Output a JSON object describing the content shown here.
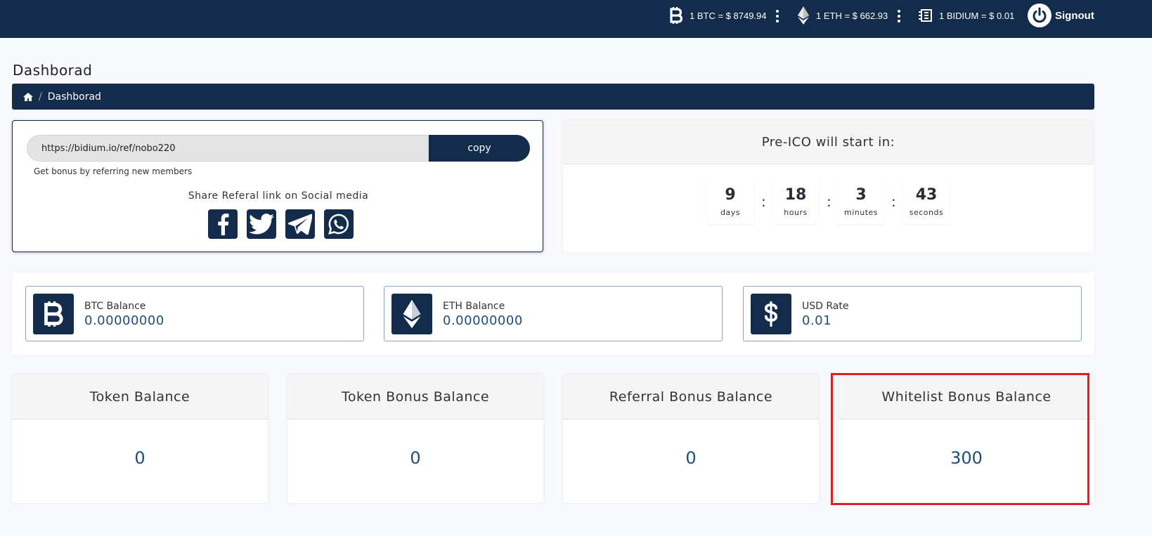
{
  "topbar": {
    "rates": [
      {
        "icon": "bitcoin-icon",
        "label": "1 BTC = $ 8749.94"
      },
      {
        "icon": "ethereum-icon",
        "label": "1 ETH = $ 662.93"
      },
      {
        "icon": "bidium-icon",
        "label": "1 BIDIUM = $ 0.01"
      }
    ],
    "signout_label": "Signout"
  },
  "page": {
    "title": "Dashborad",
    "breadcrumb": {
      "current": "Dashborad"
    }
  },
  "referral": {
    "link": "https://bidium.io/ref/nobo220",
    "copy_label": "copy",
    "hint": "Get bonus by referring new members",
    "share_title": "Share Referal link on Social media",
    "socials": [
      "facebook",
      "twitter",
      "telegram",
      "whatsapp"
    ]
  },
  "countdown": {
    "title": "Pre-ICO will start in:",
    "units": [
      {
        "value": "9",
        "label": "days"
      },
      {
        "value": "18",
        "label": "hours"
      },
      {
        "value": "3",
        "label": "minutes"
      },
      {
        "value": "43",
        "label": "seconds"
      }
    ],
    "separator": ":"
  },
  "balances": [
    {
      "icon": "bitcoin-icon",
      "label": "BTC Balance",
      "value": "0.00000000"
    },
    {
      "icon": "ethereum-icon",
      "label": "ETH Balance",
      "value": "0.00000000"
    },
    {
      "icon": "dollar-icon",
      "label": "USD Rate",
      "value": "0.01"
    }
  ],
  "tokens": [
    {
      "label": "Token Balance",
      "value": "0"
    },
    {
      "label": "Token Bonus Balance",
      "value": "0"
    },
    {
      "label": "Referral Bonus Balance",
      "value": "0"
    },
    {
      "label": "Whitelist Bonus Balance",
      "value": "300"
    }
  ],
  "colors": {
    "navy": "#132c4b",
    "value_blue": "#1e4e7a",
    "highlight_red": "#e02020"
  }
}
